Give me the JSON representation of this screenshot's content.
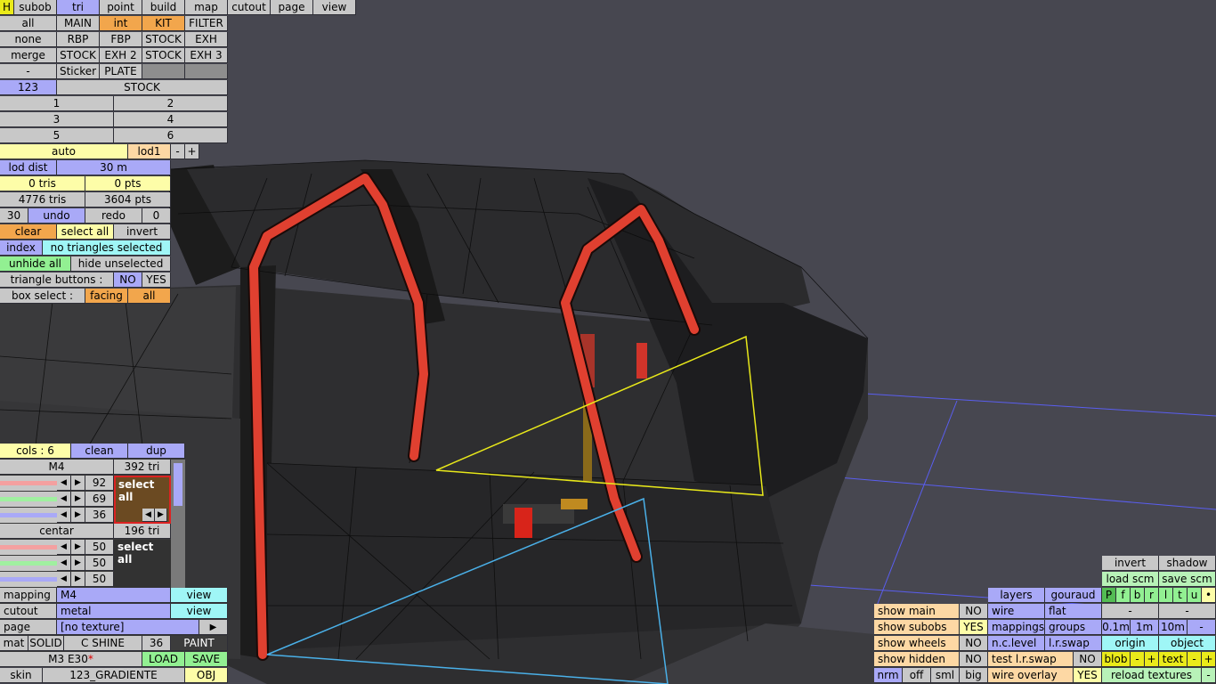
{
  "topbar": {
    "h": "H",
    "subob": "subob",
    "tri": "tri",
    "point": "point",
    "build": "build",
    "map": "map",
    "cutout": "cutout",
    "page": "page",
    "view": "view"
  },
  "row1": {
    "all": "all",
    "main": "MAIN",
    "int": "int",
    "kit": "KIT",
    "filter": "FILTER"
  },
  "row2": {
    "none": "none",
    "rbp": "RBP",
    "fbp": "FBP",
    "stock": "STOCK",
    "exh": "EXH"
  },
  "row3": {
    "merge": "merge",
    "stock1": "STOCK",
    "exh2": "EXH 2",
    "stock2": "STOCK",
    "exh3": "EXH 3"
  },
  "row4": {
    "dash": "-",
    "sticker": "Sticker",
    "plate": "PLATE"
  },
  "row5": {
    "num": "123",
    "stock": "STOCK"
  },
  "pages": [
    "1",
    "2",
    "3",
    "4",
    "5",
    "6"
  ],
  "lod": {
    "auto": "auto",
    "lod1": "lod1",
    "minus": "-",
    "plus": "+",
    "dist_label": "lod dist",
    "dist_value": "30 m"
  },
  "stats": {
    "tris_sel": "0 tris",
    "pts_sel": "0 pts",
    "tris_total": "4776 tris",
    "pts_total": "3604 pts"
  },
  "undo": {
    "left": "30",
    "undo": "undo",
    "redo": "redo",
    "right": "0"
  },
  "sel": {
    "clear": "clear",
    "select_all": "select all",
    "invert": "invert",
    "index": "index",
    "none_sel": "no triangles selected",
    "unhide": "unhide all",
    "hide_unsel": "hide unselected",
    "tri_btn_label": "triangle buttons :",
    "no": "NO",
    "yes": "YES",
    "box_label": "box select :",
    "facing": "facing",
    "all": "all"
  },
  "colors": {
    "cols": "cols : 6",
    "clean": "clean",
    "dup": "dup",
    "mat1": {
      "name": "M4",
      "tris": "392 tri",
      "v1": "92",
      "v2": "69",
      "v3": "36",
      "select_all": "select all",
      "swatch": "#6b4a22",
      "r": 0.36,
      "g": 0.27,
      "b": 0.14
    },
    "mat2": {
      "name": "centar",
      "tris": "196 tri",
      "v1": "50",
      "v2": "50",
      "v3": "50",
      "select_all": "select all",
      "swatch": "#323232",
      "r": 0.2,
      "g": 0.2,
      "b": 0.2
    }
  },
  "material": {
    "mapping_label": "mapping",
    "mapping_value": "M4",
    "view1": "view",
    "cutout_label": "cutout",
    "cutout_value": "metal",
    "view2": "view",
    "page_label": "page",
    "page_value": "[no texture]",
    "mat": "mat",
    "solid": "SOLID",
    "cshine": "C SHINE",
    "num": "36",
    "paint": "PAINT",
    "car": "M3 E30",
    "star": "*",
    "load": "LOAD",
    "save": "SAVE",
    "skin_label": "skin",
    "skin_value": "123_GRADIENTE",
    "obj": "OBJ"
  },
  "right": {
    "invert": "invert",
    "shadow": "shadow",
    "load_scm": "load scm",
    "save_scm": "save scm",
    "layers": "layers",
    "gouraud": "gouraud",
    "letters": [
      "P",
      "f",
      "b",
      "r",
      "l",
      "t",
      "u",
      "•"
    ],
    "show_main": "show main",
    "no1": "NO",
    "wire": "wire",
    "flat": "flat",
    "dash1": "-",
    "dash2": "-",
    "show_subobs": "show subobs",
    "yes1": "YES",
    "mappings": "mappings",
    "groups": "groups",
    "d01": "0.1m",
    "d1": "1m",
    "d10": "10m",
    "dash3": "-",
    "show_wheels": "show wheels",
    "no2": "NO",
    "nclevel": "n.c.level",
    "lrswap": "l.r.swap",
    "origin": "origin",
    "object": "object",
    "show_hidden": "show hidden",
    "no3": "NO",
    "test_swap": "test l.r.swap",
    "no4": "NO",
    "blob": "blob",
    "text": "text",
    "pm": [
      "-",
      "+",
      "-",
      "+"
    ],
    "nrm": "nrm",
    "off": "off",
    "sml": "sml",
    "big": "big",
    "wire_overlay": "wire overlay",
    "yes2": "YES",
    "reload": "reload textures",
    "dash4": "-"
  }
}
